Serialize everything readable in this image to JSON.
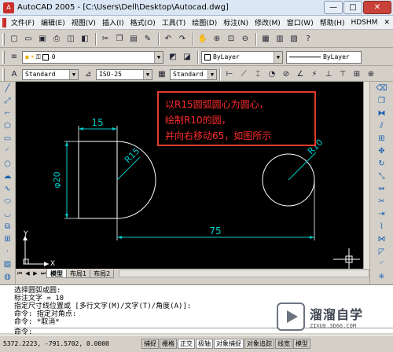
{
  "window": {
    "title": "AutoCAD 2005 - [C:\\Users\\Dell\\Desktop\\Autocad.dwg]",
    "min_label": "—",
    "max_label": "□",
    "close_label": "✕"
  },
  "menu": {
    "items": [
      "文件(F)",
      "编辑(E)",
      "视图(V)",
      "插入(I)",
      "格式(O)",
      "工具(T)",
      "绘图(D)",
      "标注(N)",
      "修改(M)",
      "窗口(W)",
      "帮助(H)",
      "HDSHM"
    ],
    "close_label": "✕"
  },
  "toolbars": {
    "layer_value": "0",
    "color_value": "ByLayer",
    "linetype_value": "ByLayer",
    "text_style": "Standard",
    "dim_style": "ISO-25",
    "table_style": "Standard"
  },
  "drawing": {
    "dim_15": "15",
    "dim_r15": "R15",
    "dim_d20": "φ20",
    "dim_r10": "R10",
    "dim_75": "75",
    "ucs_x": "X",
    "ucs_y": "Y"
  },
  "annotation": {
    "lines": [
      "以R15圆弧圆心为圆心，",
      "绘制R10的圆，",
      "并向右移动65，如图所示"
    ]
  },
  "tabs": [
    "模型",
    "布局1",
    "布局2"
  ],
  "command": {
    "lines": [
      "选择圆弧或圆:",
      "标注文字 = 10",
      "指定尺寸线位置或 [多行文字(M)/文字(T)/角度(A)]:",
      "命令: 指定对角点:",
      "命令: *取消*"
    ],
    "prompt": "命令:"
  },
  "status": {
    "coords": "5372.2223,  -791.5702, 0.0000",
    "buttons": [
      "捕捉",
      "栅格",
      "正交",
      "极轴",
      "对象捕捉",
      "对象追踪",
      "线宽",
      "模型"
    ]
  },
  "watermark": {
    "title": "溜溜自学",
    "url": "ZIXUE.3D66.COM"
  }
}
